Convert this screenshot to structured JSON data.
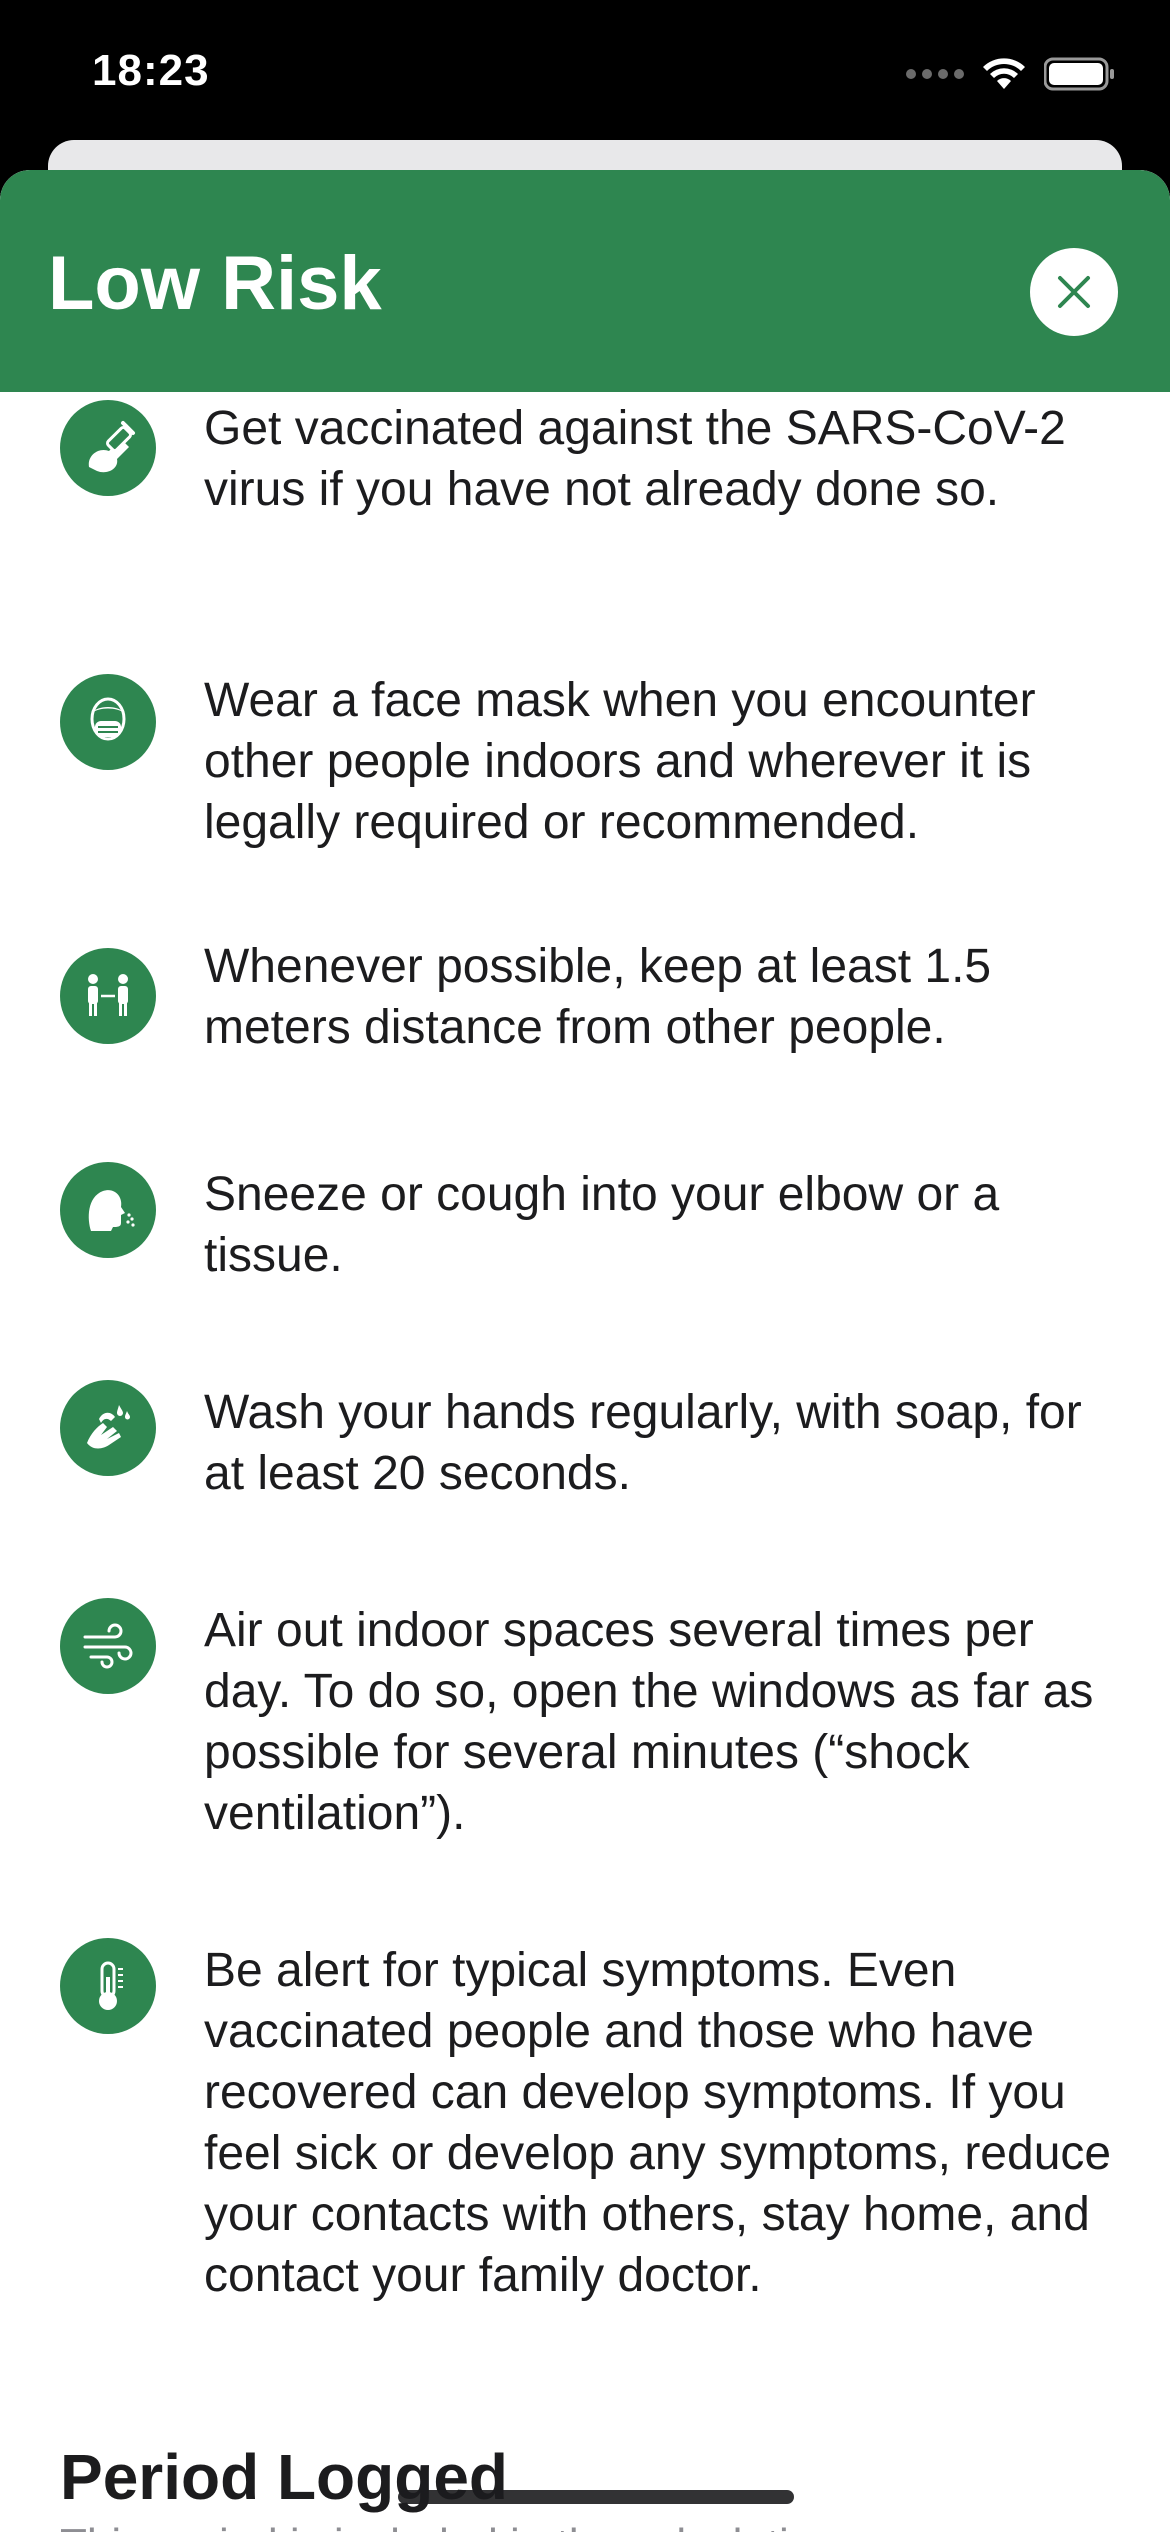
{
  "status_bar": {
    "time": "18:23"
  },
  "header": {
    "title": "Low Risk",
    "close_icon": "close-icon"
  },
  "tips": [
    {
      "icon": "vaccine-icon",
      "text": "Get vaccinated against the SARS-CoV-2 virus if you have not already done so."
    },
    {
      "icon": "face-mask-icon",
      "text": "Wear a face mask when you encounter other people indoors and wherever it is legally required or recommended."
    },
    {
      "icon": "distance-icon",
      "text": "Whenever possible, keep at least 1.5 meters distance from other people."
    },
    {
      "icon": "sneeze-icon",
      "text": "Sneeze or cough into your elbow or a tissue."
    },
    {
      "icon": "hand-wash-icon",
      "text": "Wash your hands regularly, with soap, for at least 20 seconds."
    },
    {
      "icon": "ventilation-icon",
      "text": "Air out indoor spaces several times per day. To do so, open the windows as far as possible for several minutes (“shock ventilation”)."
    },
    {
      "icon": "thermometer-icon",
      "text": "Be alert for typical symptoms. Even vaccinated people and those who have recovered can develop symptoms. If you feel sick or develop any symptoms, reduce your contacts with others, stay home, and contact your family doctor."
    }
  ],
  "period_section": {
    "title": "Period Logged",
    "subtitle": "This period is included in the calculation"
  },
  "colors": {
    "accent": "#2e8650",
    "text": "#1c1c1e"
  }
}
